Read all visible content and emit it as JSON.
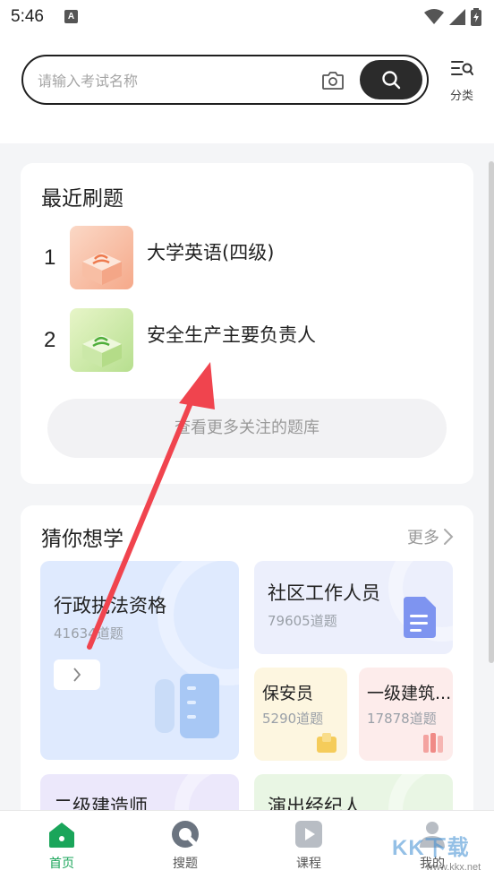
{
  "status_bar": {
    "time": "5:46",
    "notif_letter": "A"
  },
  "header": {
    "search_placeholder": "请输入考试名称",
    "category_label": "分类"
  },
  "recent": {
    "title": "最近刷题",
    "items": [
      {
        "rank": "1",
        "name": "大学英语(四级)"
      },
      {
        "rank": "2",
        "name": "安全生产主要负责人"
      }
    ],
    "more_label": "查看更多关注的题库"
  },
  "guess": {
    "title": "猜你想学",
    "more_label": "更多",
    "tiles": [
      {
        "name": "行政执法资格",
        "count": "41634道题"
      },
      {
        "name": "社区工作人员",
        "count": "79605道题"
      },
      {
        "name": "保安员",
        "count": "5290道题"
      },
      {
        "name": "一级建筑...",
        "count": "17878道题"
      },
      {
        "name": "二级建造师",
        "count": ""
      },
      {
        "name": "演出经纪人",
        "count": ""
      }
    ]
  },
  "bottom_nav": [
    {
      "label": "首页",
      "icon": "home-icon",
      "active": true
    },
    {
      "label": "搜题",
      "icon": "search-question-icon",
      "active": false
    },
    {
      "label": "课程",
      "icon": "play-icon",
      "active": false
    },
    {
      "label": "我的",
      "icon": "user-icon",
      "active": false
    }
  ],
  "watermark": {
    "main": "KK下载",
    "sub": "www.kkx.net"
  },
  "colors": {
    "accent": "#1aa55a",
    "search_button": "#2b2b2b",
    "arrow": "#f0444e"
  }
}
